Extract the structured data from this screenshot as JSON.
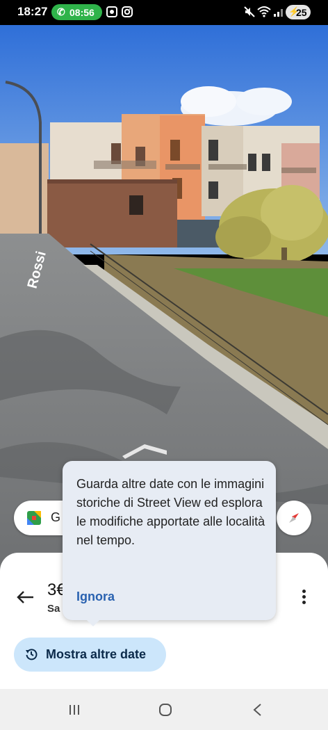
{
  "status": {
    "time": "18:27",
    "call_timer": "08:56",
    "battery": "25"
  },
  "scene": {
    "street_label": "Rossi"
  },
  "search_chip": {
    "text": "G"
  },
  "sheet": {
    "title": "3€",
    "subtitle": "Sa",
    "dates_button": "Mostra altre date"
  },
  "tooltip": {
    "message": "Guarda altre date con le immagini storiche di Street View ed esplora le modifiche apportate alle località nel tempo.",
    "dismiss": "Ignora"
  },
  "colors": {
    "accent": "#2a62b0",
    "chip_bg": "#cce6fb",
    "call_green": "#2fb34a"
  },
  "icons": [
    "phone-icon",
    "screen-record-icon",
    "instagram-icon",
    "mute-icon",
    "wifi-icon",
    "signal-icon",
    "battery-icon",
    "maps-logo-icon",
    "compass-icon",
    "back-arrow-icon",
    "more-vert-icon",
    "history-icon",
    "nav-recent-icon",
    "nav-home-icon",
    "nav-back-icon"
  ]
}
